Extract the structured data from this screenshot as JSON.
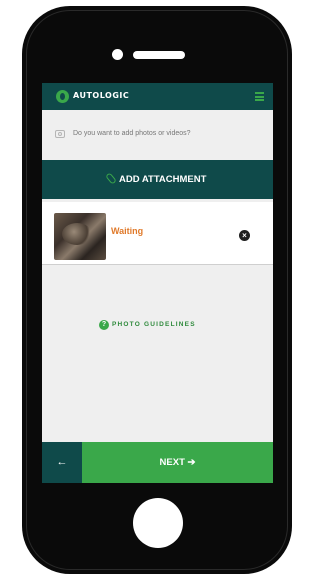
{
  "header": {
    "logo_text": "AUTOLOGIC"
  },
  "prompt": {
    "text": "Do you want to add photos or videos?"
  },
  "attachment": {
    "button_label": "ADD ATTACHMENT"
  },
  "attachments": [
    {
      "status": "Waiting"
    }
  ],
  "guidelines": {
    "label": "PHOTO GUIDELINES",
    "icon_glyph": "?"
  },
  "footer": {
    "back_glyph": "←",
    "next_label": "NEXT ➔"
  },
  "colors": {
    "brand_dark": "#0f4a4a",
    "brand_green": "#3aa84a",
    "status_orange": "#e07a2b",
    "screen_bg": "#efefef"
  },
  "icons": [
    "logo-icon",
    "menu-icon",
    "camera-icon",
    "paperclip-icon",
    "remove-icon",
    "help-icon",
    "back-arrow-icon",
    "next-arrow-icon"
  ]
}
